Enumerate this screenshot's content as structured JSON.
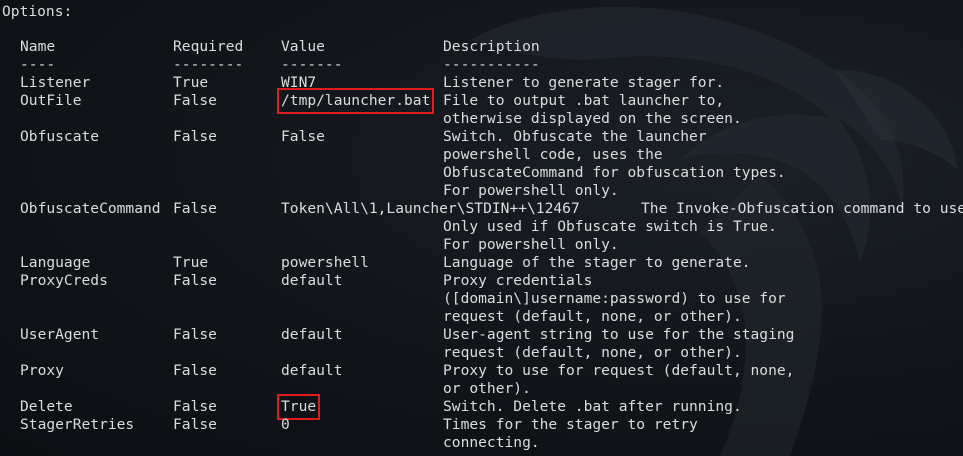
{
  "header": "Options:",
  "columns": {
    "name": "Name",
    "required": "Required",
    "value": "Value",
    "description": "Description",
    "name_rule": "----",
    "required_rule": "--------",
    "value_rule": "-------",
    "description_rule": "-----------"
  },
  "rows": [
    {
      "name": "Listener",
      "required": "True",
      "value": "WIN7",
      "description": [
        "Listener to generate stager for."
      ]
    },
    {
      "name": "OutFile",
      "required": "False",
      "value": "/tmp/launcher.bat",
      "highlighted": true,
      "description": [
        "File to output .bat launcher to,",
        "otherwise displayed on the screen."
      ]
    },
    {
      "name": "Obfuscate",
      "required": "False",
      "value": "False",
      "description": [
        "Switch. Obfuscate the launcher",
        "powershell code, uses the",
        "ObfuscateCommand for obfuscation types.",
        "For powershell only."
      ]
    },
    {
      "name": "ObfuscateCommand",
      "required": "False",
      "value": "Token\\All\\1,Launcher\\STDIN++\\12467",
      "description": [
        "The Invoke-Obfuscation command to use.",
        "Only used if Obfuscate switch is True.",
        "For powershell only."
      ]
    },
    {
      "name": "Language",
      "required": "True",
      "value": "powershell",
      "description": [
        "Language of the stager to generate."
      ]
    },
    {
      "name": "ProxyCreds",
      "required": "False",
      "value": "default",
      "description": [
        "Proxy credentials",
        "([domain\\]username:password) to use for",
        "request (default, none, or other)."
      ]
    },
    {
      "name": "UserAgent",
      "required": "False",
      "value": "default",
      "description": [
        "User-agent string to use for the staging",
        "request (default, none, or other)."
      ]
    },
    {
      "name": "Proxy",
      "required": "False",
      "value": "default",
      "description": [
        "Proxy to use for request (default, none,",
        "or other)."
      ]
    },
    {
      "name": "Delete",
      "required": "False",
      "value": "True",
      "highlighted": true,
      "description": [
        "Switch. Delete .bat after running."
      ]
    },
    {
      "name": "StagerRetries",
      "required": "False",
      "value": "0",
      "description": [
        "Times for the stager to retry",
        "connecting."
      ]
    }
  ],
  "colors": {
    "background": "#0f1318",
    "text": "#dcdcdc",
    "highlight_box": "#e01b1b"
  },
  "background_image": "kali-dragon-watermark"
}
